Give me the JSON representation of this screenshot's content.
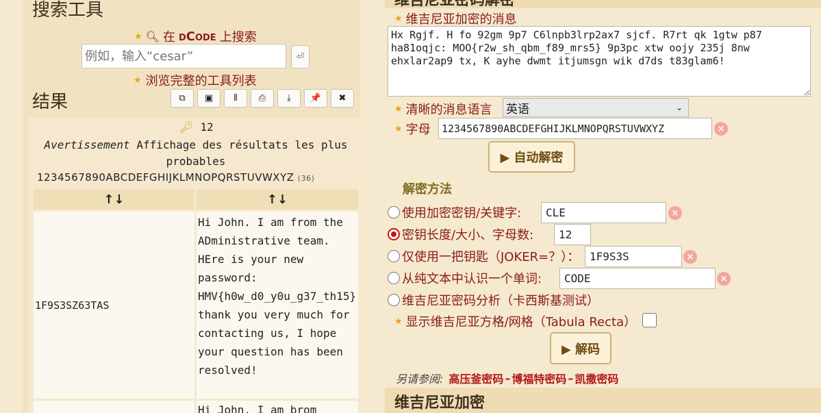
{
  "left": {
    "search_title": "搜索工具",
    "search_link_prefix": "在",
    "search_link_brand": "dCode",
    "search_link_suffix": "上搜索",
    "search_placeholder": "例如，输入“cesar”",
    "enter_symbol": "⏎",
    "browse_link": "浏览完整的工具列表",
    "results_title": "结果",
    "toolbar": [
      "copy-icon",
      "save-icon",
      "columns-icon",
      "print-icon",
      "download-icon",
      "pin-icon",
      "close-icon"
    ],
    "toolbar_glyphs": [
      "⧉",
      "▣",
      "⦀",
      "⎙",
      "⤓",
      "📌",
      "✖"
    ],
    "key_count": "12",
    "warning_label": "Avertissement",
    "warning_text": "Affichage des résultats les plus probables",
    "alphabet": "1234567890ABCDEFGHIJKLMNOPQRSTUVWXYZ",
    "alphabet_len": "(36)",
    "sort_glyph": "↑↓",
    "rows": [
      {
        "key": "1F9S3SZ63TAS",
        "text": "Hi John. I am from the ADministrative team. HEre is your new password: HMV{h0w_d0_y0u_g37_th15} thank you very much for contacting us, I hope your question has been resolved!"
      },
      {
        "key": "",
        "text": "Hi John. I am brom"
      }
    ]
  },
  "right": {
    "top_partial_title": "维吉尼亚密码解密",
    "msg_label": "维吉尼亚加密的消息",
    "ciphertext": "Hx Rgjf. H fo 92gm 9p7 C6lnpb3lrp2ax7 sjcf. R7rt qk 1gtw p87 ha81oqjc: MOO{r2w_sh_qbm_f89_mrs5} 9p3pc xtw oojy 235j 8nw ehxlar2ap9 tx, K ayhe dwmt itjumsgn wik d7ds t83glam6!",
    "lang_label": "清晰的消息语言",
    "lang_value": "英语",
    "alphabet_label": "字母",
    "alphabet_value": "1234567890ABCDEFGHIJKLMNOPQRSTUVWXYZ",
    "auto_btn": "▶ 自动解密",
    "method_title": "解密方法",
    "opt_key_label": "使用加密密钥/关键字:",
    "opt_key_value": "CLE",
    "opt_len_label": "密钥长度/大小、字母数:",
    "opt_len_value": "12",
    "opt_joker_label": "仅使用一把钥匙（JOKER=？）：",
    "opt_joker_value": "1F9S3S",
    "opt_word_label": "从纯文本中认识一个单词:",
    "opt_word_value": "CODE",
    "opt_kasiski_label": "维吉尼亚密码分析（卡西斯基测试）",
    "tabula_label": "显示维吉尼亚方格/网格（Tabula Recta）",
    "decode_btn": "▶ 解码",
    "see_also_label": "另请参阅:",
    "see_also_links": [
      "高压釜密码",
      "博福特密码",
      "凯撒密码"
    ],
    "bottom_title": "维吉尼亚加密"
  }
}
